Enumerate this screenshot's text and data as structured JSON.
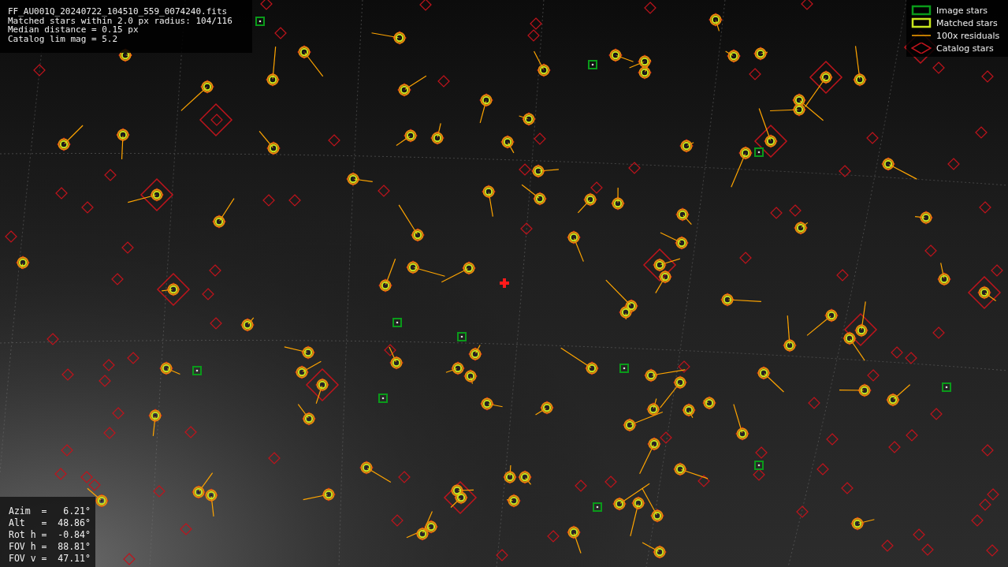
{
  "info_box": {
    "lines": [
      "FF_AU001Q_20240722_104510_559_0074240.fits",
      "Matched stars within 2.0 px radius: 104/116",
      "Median distance = 0.15 px",
      "Catalog lim mag = 5.2"
    ]
  },
  "legend": {
    "items": [
      {
        "kind": "image",
        "label": "Image stars"
      },
      {
        "kind": "matched",
        "label": "Matched stars"
      },
      {
        "kind": "residual",
        "label": "100x residuals"
      },
      {
        "kind": "catalog",
        "label": "Catalog stars"
      }
    ]
  },
  "pointing_box": {
    "lines": [
      "Azim  =   6.21°",
      "Alt   =  48.86°",
      "Rot h =  -0.84°",
      "FOV h =  88.81°",
      "FOV v =  47.11°"
    ]
  }
}
